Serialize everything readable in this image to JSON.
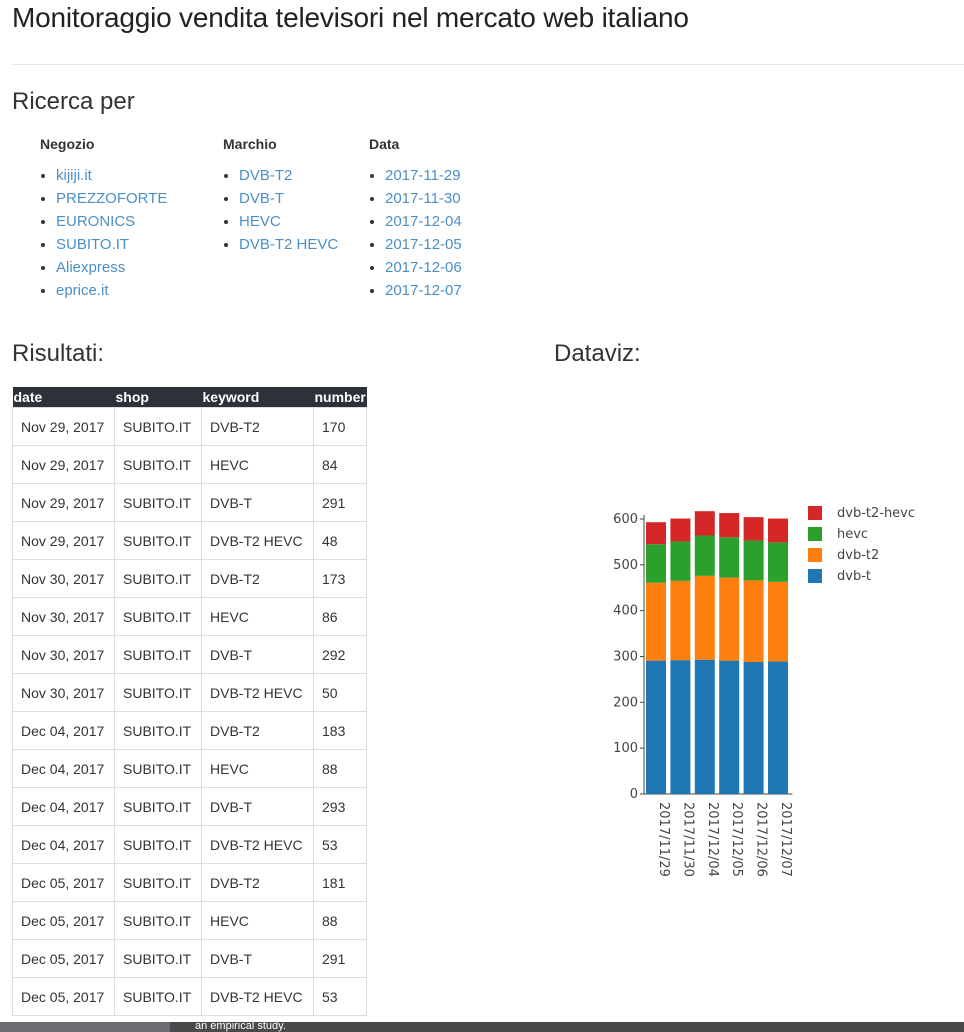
{
  "page_title": "Monitoraggio vendita televisori nel mercato web italiano",
  "search": {
    "heading": "Ricerca per",
    "columns": [
      {
        "title": "Negozio",
        "items": [
          "kijiji.it",
          "PREZZOFORTE",
          "EURONICS",
          "SUBITO.IT",
          "Aliexpress",
          "eprice.it"
        ]
      },
      {
        "title": "Marchio",
        "items": [
          "DVB-T2",
          "DVB-T",
          "HEVC",
          "DVB-T2 HEVC"
        ]
      },
      {
        "title": "Data",
        "items": [
          "2017-11-29",
          "2017-11-30",
          "2017-12-04",
          "2017-12-05",
          "2017-12-06",
          "2017-12-07"
        ]
      }
    ]
  },
  "results": {
    "heading": "Risultati:",
    "columns": [
      "date",
      "shop",
      "keyword",
      "number"
    ],
    "rows": [
      [
        "Nov 29, 2017",
        "SUBITO.IT",
        "DVB-T2",
        "170"
      ],
      [
        "Nov 29, 2017",
        "SUBITO.IT",
        "HEVC",
        "84"
      ],
      [
        "Nov 29, 2017",
        "SUBITO.IT",
        "DVB-T",
        "291"
      ],
      [
        "Nov 29, 2017",
        "SUBITO.IT",
        "DVB-T2 HEVC",
        "48"
      ],
      [
        "Nov 30, 2017",
        "SUBITO.IT",
        "DVB-T2",
        "173"
      ],
      [
        "Nov 30, 2017",
        "SUBITO.IT",
        "HEVC",
        "86"
      ],
      [
        "Nov 30, 2017",
        "SUBITO.IT",
        "DVB-T",
        "292"
      ],
      [
        "Nov 30, 2017",
        "SUBITO.IT",
        "DVB-T2 HEVC",
        "50"
      ],
      [
        "Dec 04, 2017",
        "SUBITO.IT",
        "DVB-T2",
        "183"
      ],
      [
        "Dec 04, 2017",
        "SUBITO.IT",
        "HEVC",
        "88"
      ],
      [
        "Dec 04, 2017",
        "SUBITO.IT",
        "DVB-T",
        "293"
      ],
      [
        "Dec 04, 2017",
        "SUBITO.IT",
        "DVB-T2 HEVC",
        "53"
      ],
      [
        "Dec 05, 2017",
        "SUBITO.IT",
        "DVB-T2",
        "181"
      ],
      [
        "Dec 05, 2017",
        "SUBITO.IT",
        "HEVC",
        "88"
      ],
      [
        "Dec 05, 2017",
        "SUBITO.IT",
        "DVB-T",
        "291"
      ],
      [
        "Dec 05, 2017",
        "SUBITO.IT",
        "DVB-T2 HEVC",
        "53"
      ]
    ]
  },
  "dataviz": {
    "heading": "Dataviz:"
  },
  "chart_data": {
    "type": "bar",
    "stacked": true,
    "categories": [
      "2017/11/29",
      "2017/11/30",
      "2017/12/04",
      "2017/12/05",
      "2017/12/06",
      "2017/12/07"
    ],
    "series": [
      {
        "name": "dvb-t",
        "values": [
          291,
          292,
          293,
          291,
          288,
          289
        ],
        "color": "#1f77b4"
      },
      {
        "name": "dvb-t2",
        "values": [
          170,
          173,
          183,
          181,
          178,
          174
        ],
        "color": "#ff7f0e"
      },
      {
        "name": "hevc",
        "values": [
          84,
          86,
          88,
          88,
          87,
          86
        ],
        "color": "#2ca02c"
      },
      {
        "name": "dvb-t2-hevc",
        "values": [
          48,
          50,
          53,
          53,
          51,
          52
        ],
        "color": "#d62728"
      }
    ],
    "legend_order": [
      "dvb-t2-hevc",
      "hevc",
      "dvb-t2",
      "dvb-t"
    ],
    "yticks": [
      "0",
      "100",
      "200",
      "300",
      "400",
      "500",
      "600"
    ],
    "ylim": [
      0,
      600
    ],
    "legend_position": "right",
    "grid": false
  },
  "footer_snippet": "an empirical study."
}
